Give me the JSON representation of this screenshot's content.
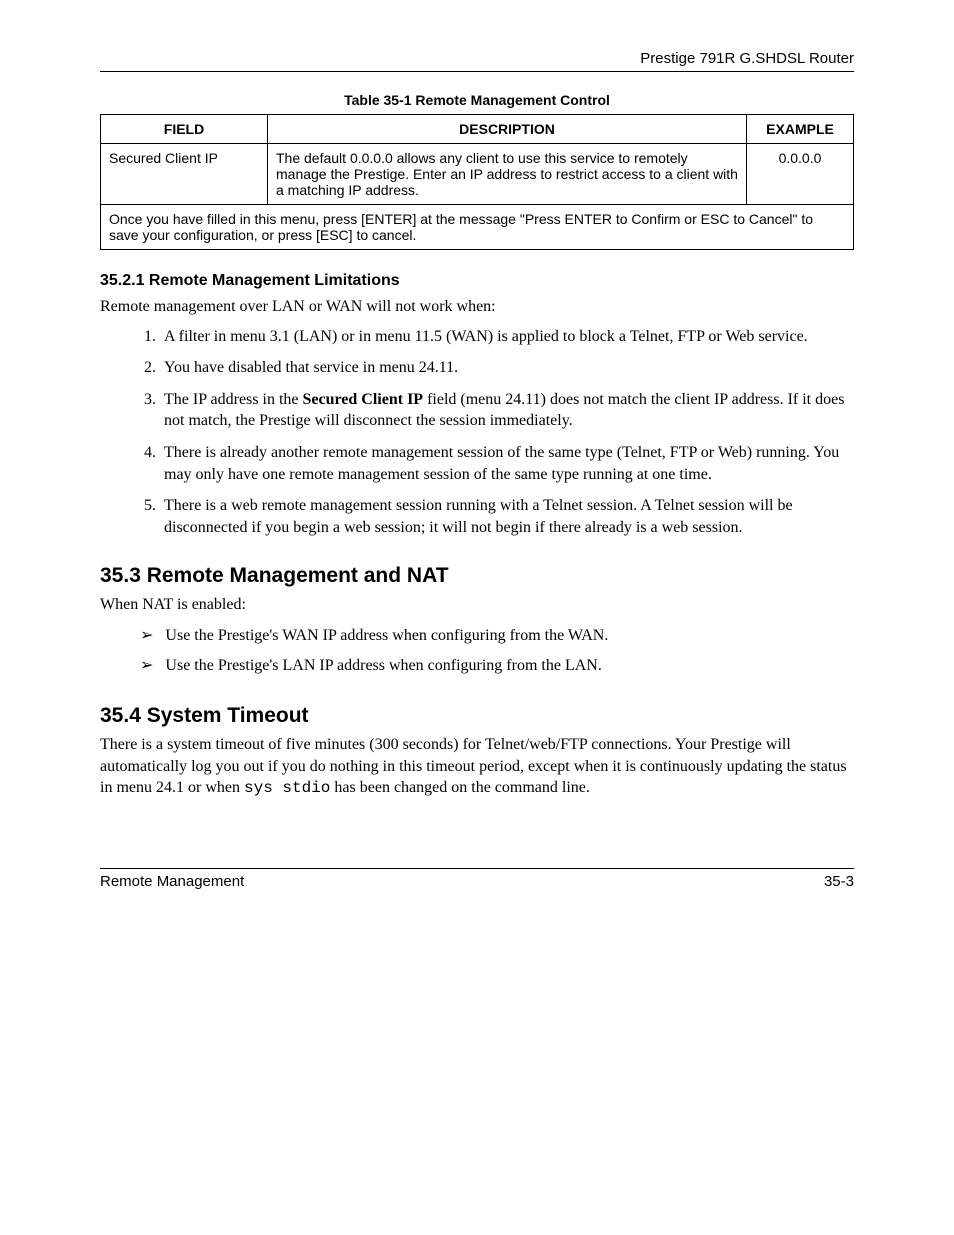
{
  "header": {
    "product": "Prestige 791R G.SHDSL Router"
  },
  "table": {
    "caption": "Table 35-1 Remote Management Control",
    "headers": {
      "field": "FIELD",
      "description": "DESCRIPTION",
      "example": "EXAMPLE"
    },
    "row": {
      "field": "Secured Client IP",
      "description": "The default 0.0.0.0 allows any client to use this service to remotely manage the Prestige. Enter an IP address to restrict access to a client with a matching IP address.",
      "example": "0.0.0.0"
    },
    "note": "Once you have filled in this menu, press [ENTER] at the message \"Press ENTER to Confirm or ESC to Cancel\" to save your configuration, or press [ESC] to cancel."
  },
  "s35_2_1": {
    "title": "35.2.1 Remote Management Limitations",
    "intro": "Remote management over LAN or WAN will not work when:",
    "items": [
      "A filter in menu 3.1 (LAN) or in menu 11.5 (WAN) is applied to block a Telnet, FTP or Web service.",
      "You have disabled that service in menu 24.11.",
      {
        "pre": "The IP address in the ",
        "bold": "Secured Client IP",
        "post": " field (menu 24.11) does not match the client IP address. If it does not match, the Prestige will disconnect the session immediately."
      },
      "There is already another remote management session of the same type (Telnet, FTP or Web) running. You may only have one remote management session of the same type running at one time.",
      "There is a web remote management session running with a Telnet session. A Telnet session will be disconnected if you begin a web session; it will not begin if there already is a web session."
    ]
  },
  "s35_3": {
    "title": "35.3  Remote Management and NAT",
    "intro": "When NAT is enabled:",
    "items": [
      "Use the Prestige's WAN IP address when configuring from the WAN.",
      "Use the Prestige's LAN IP address when configuring from the LAN."
    ]
  },
  "s35_4": {
    "title": "35.4  System Timeout",
    "para_pre": "There is a system timeout of five minutes (300 seconds) for Telnet/web/FTP connections. Your Prestige will automatically log you out if you do nothing in this timeout period, except when it is continuously updating the status in menu 24.1 or when ",
    "code": "sys stdio",
    "para_post": " has been changed on the command line."
  },
  "footer": {
    "left": "Remote Management",
    "right": "35-3"
  }
}
